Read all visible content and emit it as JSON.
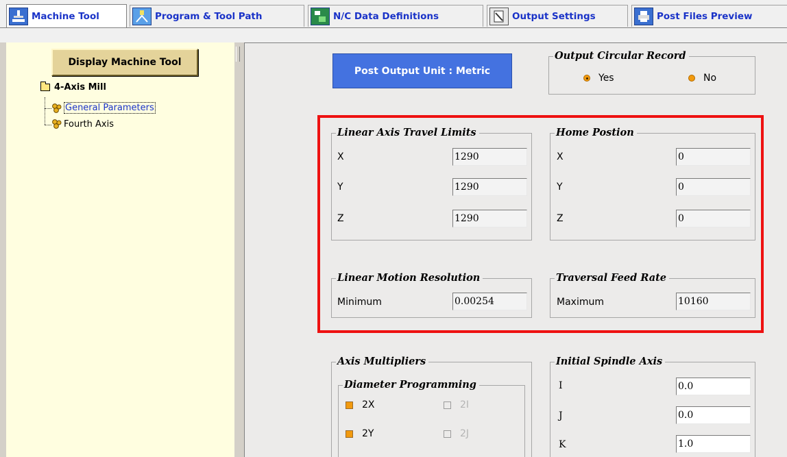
{
  "tabs": [
    {
      "label": "Machine Tool",
      "icon": "machine-tool-icon",
      "active": true
    },
    {
      "label": "Program & Tool Path",
      "icon": "tool-path-icon",
      "active": false
    },
    {
      "label": "N/C Data Definitions",
      "icon": "nc-data-icon",
      "active": false
    },
    {
      "label": "Output Settings",
      "icon": "output-settings-icon",
      "active": false
    },
    {
      "label": "Post Files Preview",
      "icon": "printer-icon",
      "active": false
    }
  ],
  "sidebar": {
    "display_button": "Display Machine Tool",
    "tree": {
      "root": "4-Axis Mill",
      "children": [
        "General Parameters",
        "Fourth Axis"
      ],
      "selected": "General Parameters"
    }
  },
  "main": {
    "unit_button": "Post Output Unit : Metric",
    "output_circular": {
      "title": "Output Circular Record",
      "options": [
        "Yes",
        "No"
      ],
      "selected": "Yes"
    },
    "travel_limits": {
      "title": "Linear Axis Travel Limits",
      "rows": [
        {
          "label": "X",
          "value": "1290"
        },
        {
          "label": "Y",
          "value": "1290"
        },
        {
          "label": "Z",
          "value": "1290"
        }
      ]
    },
    "home_position": {
      "title": "Home Postion",
      "rows": [
        {
          "label": "X",
          "value": "0"
        },
        {
          "label": "Y",
          "value": "0"
        },
        {
          "label": "Z",
          "value": "0"
        }
      ]
    },
    "motion_resolution": {
      "title": "Linear Motion Resolution",
      "label": "Minimum",
      "value": "0.00254"
    },
    "traversal_feed": {
      "title": "Traversal Feed Rate",
      "label": "Maximum",
      "value": "10160"
    },
    "axis_multipliers": {
      "title": "Axis Multipliers",
      "diameter_title": "Diameter Programming",
      "checks": [
        {
          "label": "2X",
          "checked": true,
          "enabled": true
        },
        {
          "label": "2I",
          "checked": false,
          "enabled": false
        },
        {
          "label": "2Y",
          "checked": true,
          "enabled": true
        },
        {
          "label": "2J",
          "checked": false,
          "enabled": false
        }
      ]
    },
    "spindle_axis": {
      "title": "Initial Spindle Axis",
      "rows": [
        {
          "label": "I",
          "value": "0.0"
        },
        {
          "label": "J",
          "value": "0.0"
        },
        {
          "label": "K",
          "value": "1.0"
        }
      ]
    }
  },
  "colors": {
    "tab_text": "#1a33c8",
    "unit_button": "#4472e0",
    "highlight": "#ee1111",
    "check_orange": "#f29a0e",
    "tree_bg": "#fffee0"
  }
}
